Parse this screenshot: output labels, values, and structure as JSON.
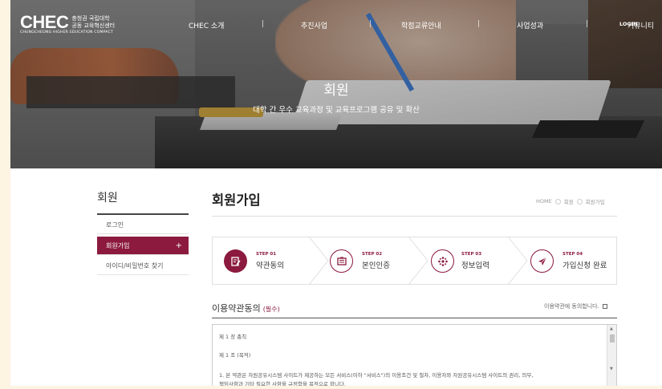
{
  "logo": {
    "main": "CHEC",
    "line1": "충청권 국립대학",
    "line2": "공동 교육혁신센터",
    "sub": "CHUNGCHEONG HIGHER EDUCATION COMPACT"
  },
  "nav": {
    "items": [
      "CHEC 소개",
      "추진사업",
      "학점교류안내",
      "사업성과",
      "커뮤니티"
    ],
    "separator": "|",
    "util": "LOGIN"
  },
  "hero": {
    "title": "회원",
    "subtitle": "대학 간 우수 교육과정 및 교육프로그램 공유 및 확산"
  },
  "sidebar": {
    "title": "회원",
    "items": [
      {
        "label": "로그인",
        "active": false
      },
      {
        "label": "회원가입",
        "active": true,
        "icon": "+"
      },
      {
        "label": "아이디/비밀번호 찾기",
        "active": false
      }
    ]
  },
  "main": {
    "title": "회원가입",
    "breadcrumb": [
      "HOME",
      "회원",
      "회원가입"
    ],
    "steps": [
      {
        "step": "STEP 01",
        "label": "약관동의",
        "icon": "document-pen-icon",
        "active": true
      },
      {
        "step": "STEP 02",
        "label": "본인인증",
        "icon": "id-card-icon",
        "active": false
      },
      {
        "step": "STEP 03",
        "label": "정보입력",
        "icon": "dots-input-icon",
        "active": false
      },
      {
        "step": "STEP 04",
        "label": "가입신청 완료",
        "icon": "paper-plane-icon",
        "active": false
      }
    ],
    "terms": {
      "title": "이용약관동의",
      "required": "(필수)",
      "agree_label": "이용약관에 동의합니다.",
      "lines": [
        "제 1 장 총칙",
        "제 1 조 (목적)",
        "1. 본 약관은 자원공유시스템 사이트가 제공하는 모든 서비스(이하 \"서비스\")의 이용조건 및 절차, 이용자와 자원공유시스템 사이트의 권리, 의무,",
        "책임사항과 기타 필요한 사항을 규정함을 목적으로 합니다."
      ]
    }
  },
  "colors": {
    "accent": "#8b1a3e",
    "frame": "#fdf4e2"
  }
}
